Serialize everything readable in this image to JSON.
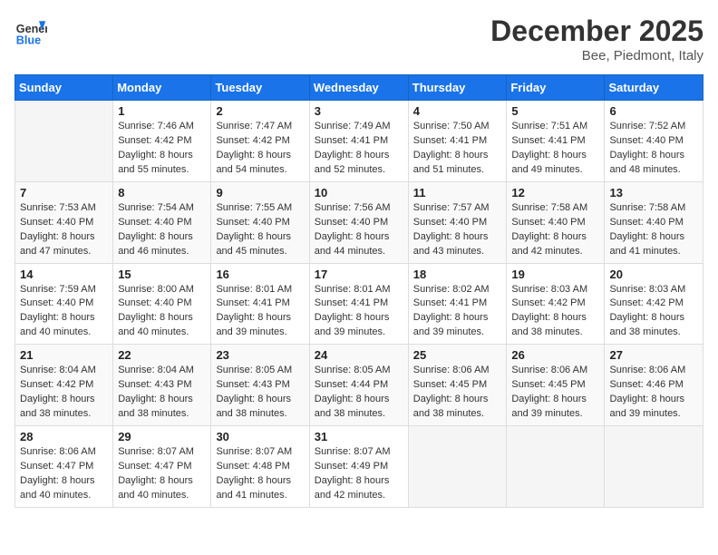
{
  "header": {
    "logo_general": "General",
    "logo_blue": "Blue",
    "month": "December 2025",
    "location": "Bee, Piedmont, Italy"
  },
  "days_of_week": [
    "Sunday",
    "Monday",
    "Tuesday",
    "Wednesday",
    "Thursday",
    "Friday",
    "Saturday"
  ],
  "weeks": [
    [
      {
        "day": "",
        "info": ""
      },
      {
        "day": "1",
        "info": "Sunrise: 7:46 AM\nSunset: 4:42 PM\nDaylight: 8 hours\nand 55 minutes."
      },
      {
        "day": "2",
        "info": "Sunrise: 7:47 AM\nSunset: 4:42 PM\nDaylight: 8 hours\nand 54 minutes."
      },
      {
        "day": "3",
        "info": "Sunrise: 7:49 AM\nSunset: 4:41 PM\nDaylight: 8 hours\nand 52 minutes."
      },
      {
        "day": "4",
        "info": "Sunrise: 7:50 AM\nSunset: 4:41 PM\nDaylight: 8 hours\nand 51 minutes."
      },
      {
        "day": "5",
        "info": "Sunrise: 7:51 AM\nSunset: 4:41 PM\nDaylight: 8 hours\nand 49 minutes."
      },
      {
        "day": "6",
        "info": "Sunrise: 7:52 AM\nSunset: 4:40 PM\nDaylight: 8 hours\nand 48 minutes."
      }
    ],
    [
      {
        "day": "7",
        "info": "Sunrise: 7:53 AM\nSunset: 4:40 PM\nDaylight: 8 hours\nand 47 minutes."
      },
      {
        "day": "8",
        "info": "Sunrise: 7:54 AM\nSunset: 4:40 PM\nDaylight: 8 hours\nand 46 minutes."
      },
      {
        "day": "9",
        "info": "Sunrise: 7:55 AM\nSunset: 4:40 PM\nDaylight: 8 hours\nand 45 minutes."
      },
      {
        "day": "10",
        "info": "Sunrise: 7:56 AM\nSunset: 4:40 PM\nDaylight: 8 hours\nand 44 minutes."
      },
      {
        "day": "11",
        "info": "Sunrise: 7:57 AM\nSunset: 4:40 PM\nDaylight: 8 hours\nand 43 minutes."
      },
      {
        "day": "12",
        "info": "Sunrise: 7:58 AM\nSunset: 4:40 PM\nDaylight: 8 hours\nand 42 minutes."
      },
      {
        "day": "13",
        "info": "Sunrise: 7:58 AM\nSunset: 4:40 PM\nDaylight: 8 hours\nand 41 minutes."
      }
    ],
    [
      {
        "day": "14",
        "info": "Sunrise: 7:59 AM\nSunset: 4:40 PM\nDaylight: 8 hours\nand 40 minutes."
      },
      {
        "day": "15",
        "info": "Sunrise: 8:00 AM\nSunset: 4:40 PM\nDaylight: 8 hours\nand 40 minutes."
      },
      {
        "day": "16",
        "info": "Sunrise: 8:01 AM\nSunset: 4:41 PM\nDaylight: 8 hours\nand 39 minutes."
      },
      {
        "day": "17",
        "info": "Sunrise: 8:01 AM\nSunset: 4:41 PM\nDaylight: 8 hours\nand 39 minutes."
      },
      {
        "day": "18",
        "info": "Sunrise: 8:02 AM\nSunset: 4:41 PM\nDaylight: 8 hours\nand 39 minutes."
      },
      {
        "day": "19",
        "info": "Sunrise: 8:03 AM\nSunset: 4:42 PM\nDaylight: 8 hours\nand 38 minutes."
      },
      {
        "day": "20",
        "info": "Sunrise: 8:03 AM\nSunset: 4:42 PM\nDaylight: 8 hours\nand 38 minutes."
      }
    ],
    [
      {
        "day": "21",
        "info": "Sunrise: 8:04 AM\nSunset: 4:42 PM\nDaylight: 8 hours\nand 38 minutes."
      },
      {
        "day": "22",
        "info": "Sunrise: 8:04 AM\nSunset: 4:43 PM\nDaylight: 8 hours\nand 38 minutes."
      },
      {
        "day": "23",
        "info": "Sunrise: 8:05 AM\nSunset: 4:43 PM\nDaylight: 8 hours\nand 38 minutes."
      },
      {
        "day": "24",
        "info": "Sunrise: 8:05 AM\nSunset: 4:44 PM\nDaylight: 8 hours\nand 38 minutes."
      },
      {
        "day": "25",
        "info": "Sunrise: 8:06 AM\nSunset: 4:45 PM\nDaylight: 8 hours\nand 38 minutes."
      },
      {
        "day": "26",
        "info": "Sunrise: 8:06 AM\nSunset: 4:45 PM\nDaylight: 8 hours\nand 39 minutes."
      },
      {
        "day": "27",
        "info": "Sunrise: 8:06 AM\nSunset: 4:46 PM\nDaylight: 8 hours\nand 39 minutes."
      }
    ],
    [
      {
        "day": "28",
        "info": "Sunrise: 8:06 AM\nSunset: 4:47 PM\nDaylight: 8 hours\nand 40 minutes."
      },
      {
        "day": "29",
        "info": "Sunrise: 8:07 AM\nSunset: 4:47 PM\nDaylight: 8 hours\nand 40 minutes."
      },
      {
        "day": "30",
        "info": "Sunrise: 8:07 AM\nSunset: 4:48 PM\nDaylight: 8 hours\nand 41 minutes."
      },
      {
        "day": "31",
        "info": "Sunrise: 8:07 AM\nSunset: 4:49 PM\nDaylight: 8 hours\nand 42 minutes."
      },
      {
        "day": "",
        "info": ""
      },
      {
        "day": "",
        "info": ""
      },
      {
        "day": "",
        "info": ""
      }
    ]
  ]
}
